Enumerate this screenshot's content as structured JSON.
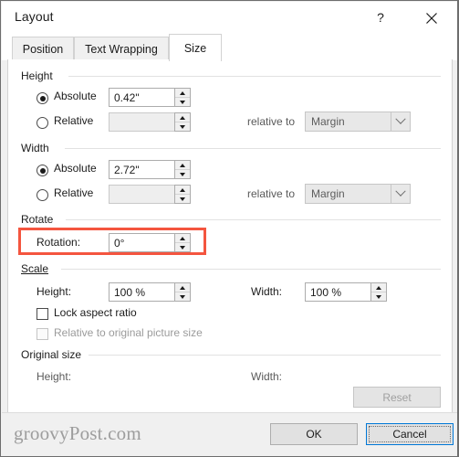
{
  "window": {
    "title": "Layout",
    "help_icon": "question-mark-icon",
    "close_icon": "close-icon"
  },
  "tabs": [
    {
      "label": "Position",
      "active": false
    },
    {
      "label": "Text Wrapping",
      "active": false
    },
    {
      "label": "Size",
      "active": true
    }
  ],
  "height_group": {
    "label": "Height",
    "absolute_label": "Absolute",
    "absolute_selected": true,
    "absolute_value": "0.42\"",
    "relative_label": "Relative",
    "relative_selected": false,
    "relative_value": "",
    "relative_to_label": "relative to",
    "relative_to_value": "Margin"
  },
  "width_group": {
    "label": "Width",
    "absolute_label": "Absolute",
    "absolute_selected": true,
    "absolute_value": "2.72\"",
    "relative_label": "Relative",
    "relative_selected": false,
    "relative_value": "",
    "relative_to_label": "relative to",
    "relative_to_value": "Margin"
  },
  "rotate_group": {
    "label": "Rotate",
    "rotation_label": "Rotation:",
    "rotation_value": "0°",
    "highlight_color": "#f4553f"
  },
  "scale_group": {
    "label": "Scale",
    "height_label": "Height:",
    "height_value": "100 %",
    "width_label": "Width:",
    "width_value": "100 %",
    "lock_aspect_label": "Lock aspect ratio",
    "lock_aspect_checked": false,
    "relative_original_label": "Relative to original picture size",
    "relative_original_checked": false,
    "relative_original_disabled": true
  },
  "original_size_group": {
    "label": "Original size",
    "height_label": "Height:",
    "height_value": "",
    "width_label": "Width:",
    "width_value": "",
    "reset_label": "Reset",
    "reset_disabled": true
  },
  "footer": {
    "ok_label": "OK",
    "cancel_label": "Cancel",
    "cancel_is_default": true,
    "watermark": "groovyPost.com"
  }
}
